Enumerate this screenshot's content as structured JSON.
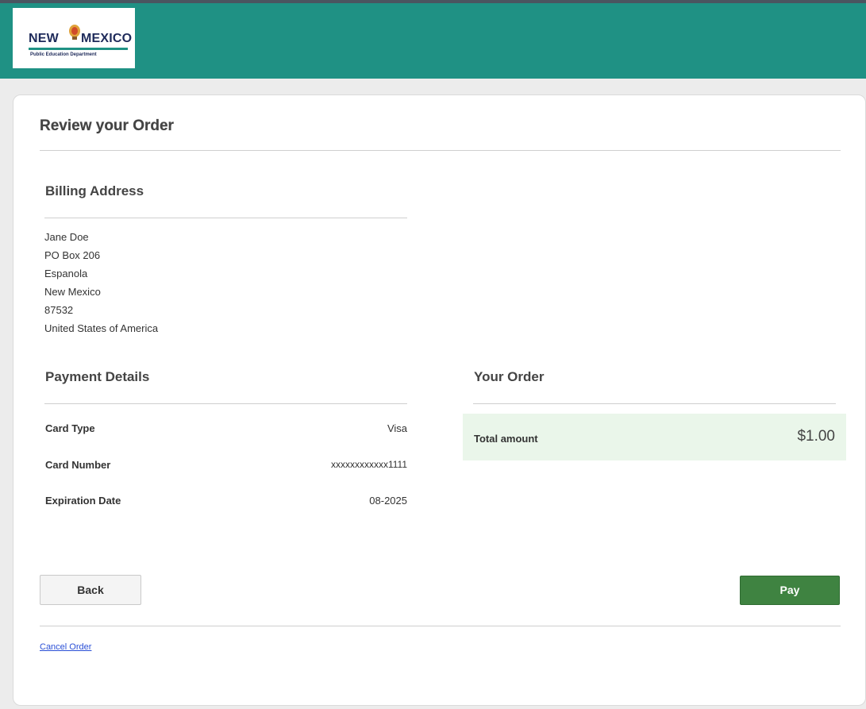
{
  "header": {
    "logo": {
      "title_left": "NEW",
      "title_right": "MEXICO",
      "subtitle": "Public Education Department"
    }
  },
  "page": {
    "title": "Review your Order"
  },
  "billing": {
    "title": "Billing Address",
    "lines": [
      "Jane Doe",
      "PO Box 206",
      "Espanola",
      "New Mexico",
      "87532",
      "United States of America"
    ]
  },
  "payment": {
    "title": "Payment Details",
    "rows": [
      {
        "label": "Card Type",
        "value": "Visa"
      },
      {
        "label": "Card Number",
        "value": "xxxxxxxxxxxx1111"
      },
      {
        "label": "Expiration Date",
        "value": "08-2025"
      }
    ]
  },
  "order": {
    "title": "Your Order",
    "total_label": "Total amount",
    "total_value": "$1.00"
  },
  "actions": {
    "back_label": "Back",
    "pay_label": "Pay",
    "cancel_label": "Cancel Order"
  },
  "colors": {
    "header": "#1f9184",
    "pay_button": "#3f8341",
    "total_bg": "#eaf6ea",
    "link": "#2a4fd6"
  }
}
